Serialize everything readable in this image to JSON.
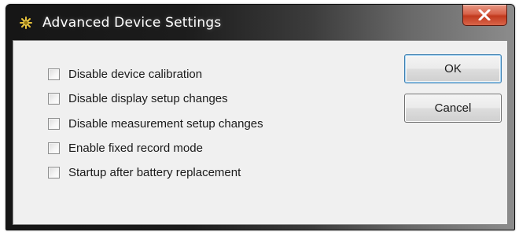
{
  "window": {
    "title": "Advanced Device Settings",
    "icon": "device-settings-icon",
    "close_icon": "close-icon",
    "close_color": "#c9452a"
  },
  "options": [
    {
      "label": "Disable device calibration",
      "checked": false
    },
    {
      "label": "Disable display setup changes",
      "checked": false
    },
    {
      "label": "Disable measurement setup changes",
      "checked": false
    },
    {
      "label": "Enable fixed record mode",
      "checked": false
    },
    {
      "label": "Startup after battery replacement",
      "checked": false
    }
  ],
  "buttons": {
    "ok_label": "OK",
    "cancel_label": "Cancel"
  }
}
